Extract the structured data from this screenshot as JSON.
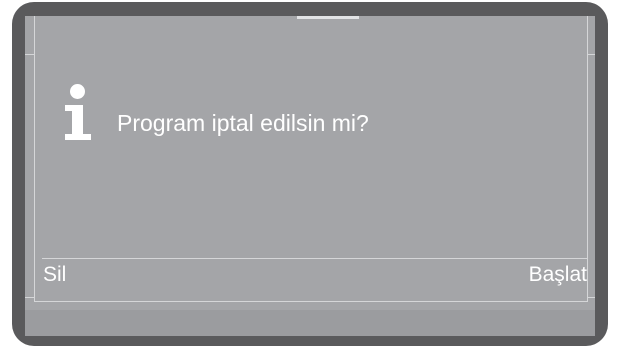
{
  "dialog": {
    "icon": "info-icon",
    "message": "Program iptal edilsin mi?"
  },
  "softkeys": {
    "left_label": "Sil",
    "right_label": "Başlat"
  },
  "colors": {
    "frame": "#5a5a5c",
    "screen": "#a4a5a8",
    "text": "#ffffff",
    "lines": "#d5d6d8"
  }
}
